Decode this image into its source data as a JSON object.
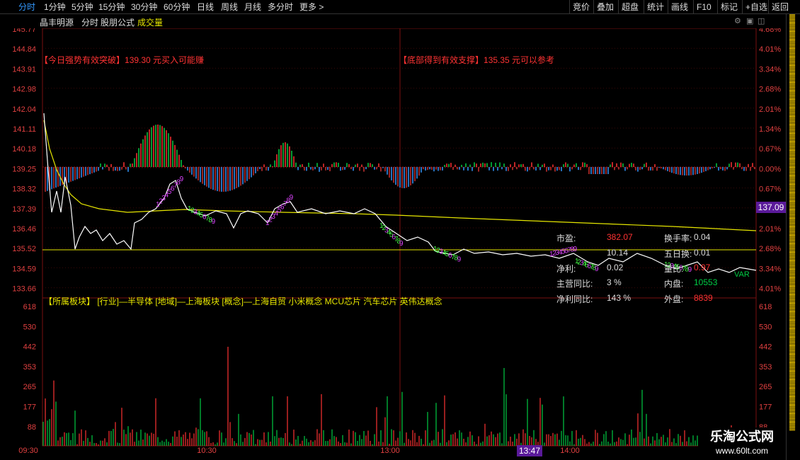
{
  "toolbar": {
    "tabs": [
      "分时",
      "1分钟",
      "5分钟",
      "15分钟",
      "30分钟",
      "60分钟",
      "日线",
      "周线",
      "月线",
      "多分时",
      "更多 >"
    ],
    "right_tabs": [
      "竞价",
      "叠加",
      "超盘",
      "统计",
      "画线",
      "F10",
      "标记",
      "+自选",
      "返回"
    ]
  },
  "header": {
    "stock_name": "晶丰明源",
    "view_1": "分时",
    "view_2": "股朋公式",
    "view_3": "成交量"
  },
  "price_axis": {
    "left_labels": [
      "145.77",
      "144.84",
      "143.91",
      "142.98",
      "142.04",
      "141.11",
      "140.18",
      "139.25",
      "138.32",
      "137.39",
      "136.46",
      "135.52",
      "134.59",
      "133.66"
    ],
    "right_labels": [
      "4.68%",
      "4.01%",
      "3.34%",
      "2.68%",
      "2.01%",
      "1.34%",
      "0.67%",
      "0.00%",
      "0.67%",
      "1.34%",
      "2.01%",
      "2.68%",
      "3.34%",
      "4.01%"
    ],
    "current_price": "137.09"
  },
  "signals": {
    "breakout": "【今日强势有效突破】",
    "breakout_text": "139.30 元买入可能赚",
    "support": "【底部得到有效支撑】",
    "support_text": "135.35 元可以参考"
  },
  "fundamentals": {
    "pe_label": "市盈:",
    "pe_value": "382.07",
    "turnover_label": "换手率:",
    "turnover_value": "0.04",
    "five_day_label": "五日换:",
    "five_day_value": "0.01",
    "mid_value": "10.14",
    "net_profit_label": "净利:",
    "net_profit_value": "0.02",
    "volume_ratio_label": "量比:",
    "volume_ratio_value": "0.97",
    "revenue_yoy_label": "主营同比:",
    "revenue_yoy_value": "3 %",
    "inner_label": "内盘:",
    "inner_value": "10553",
    "profit_yoy_label": "净利同比:",
    "profit_yoy_value": "143 %",
    "outer_label": "外盘:",
    "outer_value": "8839"
  },
  "sector_line": "【所属板块】 [行业]—半导体 [地域]—上海板块 [概念]—上海自贸 小米概念 MCU芯片 汽车芯片 英伟达概念",
  "volume_axis": {
    "labels": [
      "618",
      "530",
      "442",
      "353",
      "265",
      "177",
      "88"
    ]
  },
  "time_axis": {
    "labels": [
      "09:30",
      "10:30",
      "13:00",
      "14:00"
    ],
    "cursor_time": "13:47"
  },
  "chart_markers": [
    "VAR"
  ],
  "watermark": {
    "site_name": "乐淘公式网",
    "url": "www.60lt.com"
  },
  "colors": {
    "up": "#ff3333",
    "down": "#00cc44",
    "avg_line": "#e6e600",
    "price_line": "#ffffff",
    "axis_text": "#e04040",
    "grid": "#7a1010",
    "accent_blue": "#3399ff",
    "cursor_bg": "#5a1a9a"
  }
}
